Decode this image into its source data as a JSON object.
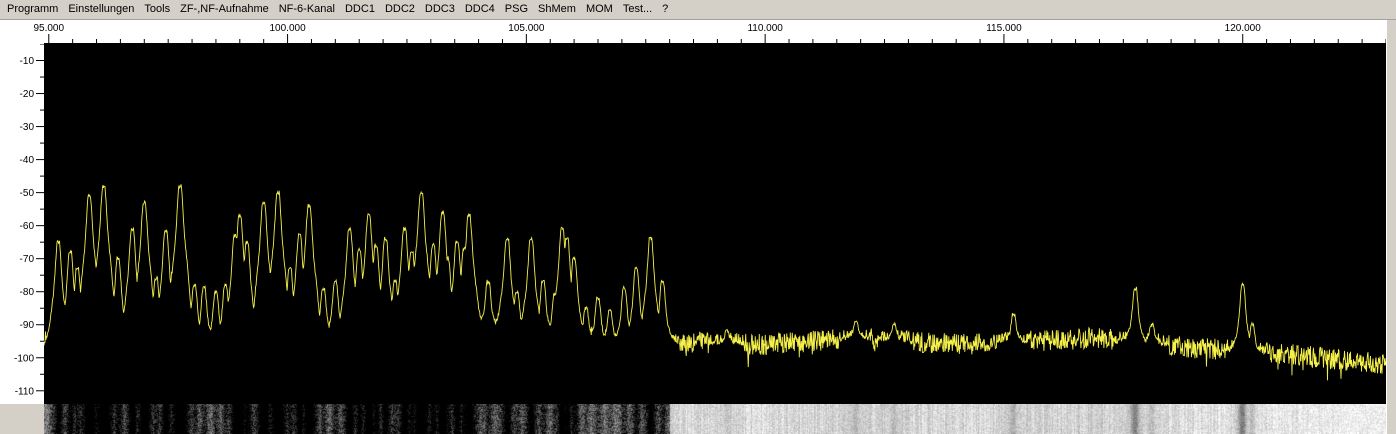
{
  "menu": {
    "items": [
      {
        "label": "Programm",
        "name": "menu-programm"
      },
      {
        "label": "Einstellungen",
        "name": "menu-einstellungen"
      },
      {
        "label": "Tools",
        "name": "menu-tools"
      },
      {
        "label": "ZF-,NF-Aufnahme",
        "name": "menu-zf-nf-aufnahme"
      },
      {
        "label": "NF-6-Kanal",
        "name": "menu-nf-6-kanal"
      },
      {
        "label": "DDC1",
        "name": "menu-ddc1"
      },
      {
        "label": "DDC2",
        "name": "menu-ddc2"
      },
      {
        "label": "DDC3",
        "name": "menu-ddc3"
      },
      {
        "label": "DDC4",
        "name": "menu-ddc4"
      },
      {
        "label": "PSG",
        "name": "menu-psg"
      },
      {
        "label": "ShMem",
        "name": "menu-shmem"
      },
      {
        "label": "MOM",
        "name": "menu-mom"
      },
      {
        "label": "Test...",
        "name": "menu-test"
      },
      {
        "label": "?",
        "name": "menu-help"
      }
    ]
  },
  "spectrum": {
    "x_ticks": [
      {
        "value": 95.0,
        "label": "95.000"
      },
      {
        "value": 100.0,
        "label": "100.000"
      },
      {
        "value": 105.0,
        "label": "105.000"
      },
      {
        "value": 110.0,
        "label": "110.000"
      },
      {
        "value": 115.0,
        "label": "115.000"
      },
      {
        "value": 120.0,
        "label": "120.000"
      }
    ],
    "y_ticks": [
      {
        "value": -10,
        "label": "-10"
      },
      {
        "value": -20,
        "label": "-20"
      },
      {
        "value": -30,
        "label": "-30"
      },
      {
        "value": -40,
        "label": "-40"
      },
      {
        "value": -50,
        "label": "-50"
      },
      {
        "value": -60,
        "label": "-60"
      },
      {
        "value": -70,
        "label": "-70"
      },
      {
        "value": -80,
        "label": "-80"
      },
      {
        "value": -90,
        "label": "-90"
      },
      {
        "value": -100,
        "label": "-100"
      },
      {
        "value": -110,
        "label": "-110"
      }
    ],
    "x_range_mhz": [
      94.9,
      123.0
    ],
    "y_range_db": [
      -114,
      -5
    ],
    "trace_color": "#f5f04a",
    "background_color": "#000000",
    "noise_floor": [
      {
        "mhz": 94.9,
        "db": -96
      },
      {
        "mhz": 100.0,
        "db": -95
      },
      {
        "mhz": 102.0,
        "db": -93
      },
      {
        "mhz": 103.5,
        "db": -89
      },
      {
        "mhz": 105.0,
        "db": -93
      },
      {
        "mhz": 107.0,
        "db": -96
      },
      {
        "mhz": 108.0,
        "db": -95
      },
      {
        "mhz": 110.0,
        "db": -96
      },
      {
        "mhz": 112.0,
        "db": -94
      },
      {
        "mhz": 114.0,
        "db": -96
      },
      {
        "mhz": 117.0,
        "db": -94
      },
      {
        "mhz": 119.0,
        "db": -97
      },
      {
        "mhz": 121.0,
        "db": -99
      },
      {
        "mhz": 123.0,
        "db": -102
      }
    ],
    "peaks": [
      {
        "mhz": 95.2,
        "db": -65
      },
      {
        "mhz": 95.45,
        "db": -68
      },
      {
        "mhz": 95.6,
        "db": -73
      },
      {
        "mhz": 95.85,
        "db": -51
      },
      {
        "mhz": 96.15,
        "db": -48
      },
      {
        "mhz": 96.45,
        "db": -70
      },
      {
        "mhz": 96.75,
        "db": -61
      },
      {
        "mhz": 97.0,
        "db": -53
      },
      {
        "mhz": 97.25,
        "db": -76
      },
      {
        "mhz": 97.45,
        "db": -62
      },
      {
        "mhz": 97.6,
        "db": -74
      },
      {
        "mhz": 97.75,
        "db": -48
      },
      {
        "mhz": 98.05,
        "db": -78
      },
      {
        "mhz": 98.25,
        "db": -79
      },
      {
        "mhz": 98.5,
        "db": -80
      },
      {
        "mhz": 98.7,
        "db": -78
      },
      {
        "mhz": 98.9,
        "db": -63
      },
      {
        "mhz": 99.0,
        "db": -57
      },
      {
        "mhz": 99.15,
        "db": -65
      },
      {
        "mhz": 99.5,
        "db": -53
      },
      {
        "mhz": 99.8,
        "db": -50
      },
      {
        "mhz": 100.05,
        "db": -73
      },
      {
        "mhz": 100.25,
        "db": -63
      },
      {
        "mhz": 100.45,
        "db": -54
      },
      {
        "mhz": 100.75,
        "db": -79
      },
      {
        "mhz": 101.0,
        "db": -77
      },
      {
        "mhz": 101.3,
        "db": -61
      },
      {
        "mhz": 101.5,
        "db": -67
      },
      {
        "mhz": 101.7,
        "db": -57
      },
      {
        "mhz": 101.85,
        "db": -66
      },
      {
        "mhz": 102.05,
        "db": -64
      },
      {
        "mhz": 102.25,
        "db": -77
      },
      {
        "mhz": 102.45,
        "db": -61
      },
      {
        "mhz": 102.6,
        "db": -68
      },
      {
        "mhz": 102.8,
        "db": -50
      },
      {
        "mhz": 103.05,
        "db": -66
      },
      {
        "mhz": 103.25,
        "db": -56
      },
      {
        "mhz": 103.35,
        "db": -70
      },
      {
        "mhz": 103.55,
        "db": -65
      },
      {
        "mhz": 103.7,
        "db": -67
      },
      {
        "mhz": 103.8,
        "db": -57
      },
      {
        "mhz": 104.2,
        "db": -77
      },
      {
        "mhz": 104.6,
        "db": -64
      },
      {
        "mhz": 104.8,
        "db": -80
      },
      {
        "mhz": 105.1,
        "db": -64
      },
      {
        "mhz": 105.35,
        "db": -77
      },
      {
        "mhz": 105.6,
        "db": -81
      },
      {
        "mhz": 105.75,
        "db": -61
      },
      {
        "mhz": 105.85,
        "db": -64
      },
      {
        "mhz": 106.0,
        "db": -70
      },
      {
        "mhz": 106.25,
        "db": -85
      },
      {
        "mhz": 106.5,
        "db": -82
      },
      {
        "mhz": 106.75,
        "db": -86
      },
      {
        "mhz": 107.05,
        "db": -79
      },
      {
        "mhz": 107.3,
        "db": -73
      },
      {
        "mhz": 107.6,
        "db": -64
      },
      {
        "mhz": 107.85,
        "db": -77
      },
      {
        "mhz": 109.2,
        "db": -92
      },
      {
        "mhz": 111.9,
        "db": -89
      },
      {
        "mhz": 112.7,
        "db": -90
      },
      {
        "mhz": 115.2,
        "db": -87
      },
      {
        "mhz": 117.75,
        "db": -79
      },
      {
        "mhz": 118.1,
        "db": -90
      },
      {
        "mhz": 120.0,
        "db": -78
      },
      {
        "mhz": 120.2,
        "db": -90
      }
    ]
  }
}
